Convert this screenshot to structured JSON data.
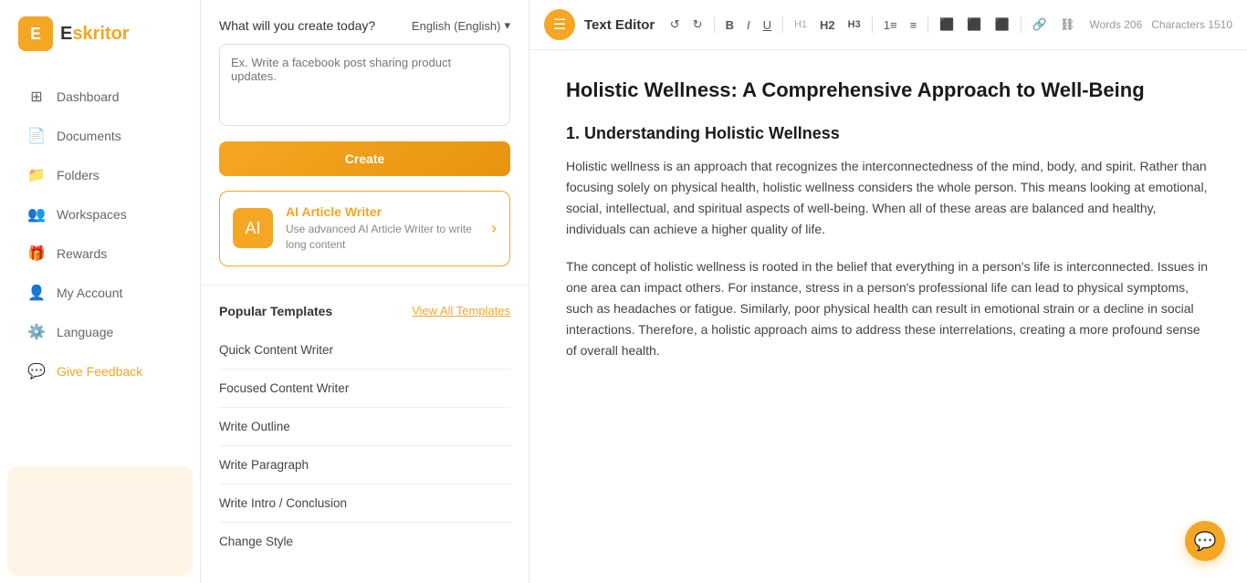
{
  "logo": {
    "icon": "E",
    "text_before": "",
    "text_brand": "skritor"
  },
  "sidebar": {
    "items": [
      {
        "id": "dashboard",
        "label": "Dashboard",
        "icon": "⊞"
      },
      {
        "id": "documents",
        "label": "Documents",
        "icon": "📄"
      },
      {
        "id": "folders",
        "label": "Folders",
        "icon": "📁"
      },
      {
        "id": "workspaces",
        "label": "Workspaces",
        "icon": "👥"
      },
      {
        "id": "rewards",
        "label": "Rewards",
        "icon": "🎁"
      },
      {
        "id": "account",
        "label": "My Account",
        "icon": "👤"
      },
      {
        "id": "language",
        "label": "Language",
        "icon": "⚙️"
      },
      {
        "id": "feedback",
        "label": "Give Feedback",
        "icon": "💬"
      }
    ]
  },
  "create_section": {
    "label": "What will you create today?",
    "language": "English (English)",
    "language_arrow": "▾",
    "textarea_placeholder": "Ex. Write a facebook post sharing product updates.",
    "create_button": "Create"
  },
  "ai_banner": {
    "icon": "AI",
    "title": "AI Article Writer",
    "subtitle": "Use advanced AI Article Writer to write long content",
    "arrow": "›"
  },
  "templates": {
    "section_title": "Popular Templates",
    "view_all_label": "View All Templates",
    "items": [
      {
        "label": "Quick Content Writer"
      },
      {
        "label": "Focused Content Writer"
      },
      {
        "label": "Write Outline"
      },
      {
        "label": "Write Paragraph"
      },
      {
        "label": "Write Intro / Conclusion"
      },
      {
        "label": "Change Style"
      }
    ]
  },
  "editor": {
    "title": "Text Editor",
    "words_label": "Words",
    "words_count": "206",
    "chars_label": "Characters",
    "chars_count": "1510",
    "toolbar": {
      "undo": "↺",
      "redo": "↻",
      "bold": "B",
      "italic": "I",
      "underline": "U",
      "h1": "H1",
      "h2": "H2",
      "h3": "H3",
      "ordered_list": "1≡",
      "unordered_list": "≡",
      "align_left": "≡",
      "align_center": "≡",
      "align_right": "≡",
      "link": "🔗",
      "unlink": "⛓"
    },
    "content": {
      "doc_title": "Holistic Wellness: A Comprehensive Approach to Well-Being",
      "h2": "1. Understanding Holistic Wellness",
      "paragraph1": "Holistic wellness is an approach that recognizes the interconnectedness of the mind, body, and spirit. Rather than focusing solely on physical health, holistic wellness considers the whole person. This means looking at emotional, social, intellectual, and spiritual aspects of well-being. When all of these areas are balanced and healthy, individuals can achieve a higher quality of life.",
      "paragraph2": "The concept of holistic wellness is rooted in the belief that everything in a person's life is interconnected. Issues in one area can impact others. For instance, stress in a person's professional life can lead to physical symptoms, such as headaches or fatigue. Similarly, poor physical health can result in emotional strain or a decline in social interactions. Therefore, a holistic approach aims to address these interrelations, creating a more profound sense of overall health."
    }
  }
}
